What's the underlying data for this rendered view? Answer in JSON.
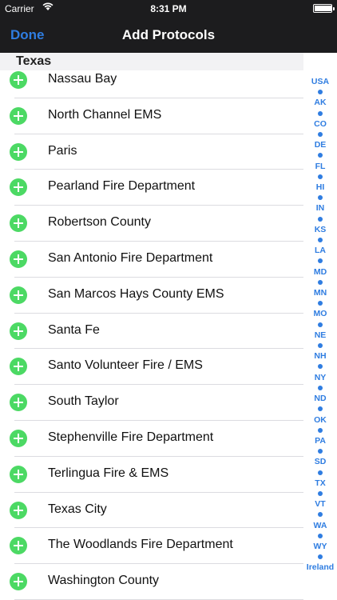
{
  "status_bar": {
    "carrier": "Carrier",
    "time": "8:31 PM",
    "battery_level": 0.95
  },
  "nav": {
    "done_label": "Done",
    "title": "Add Protocols"
  },
  "section": {
    "title": "Texas"
  },
  "rows": [
    "Nassau Bay",
    "North Channel EMS",
    "Paris",
    "Pearland Fire Department",
    "Robertson County",
    "San Antonio Fire Department",
    "San Marcos Hays County EMS",
    "Santa Fe",
    "Santo Volunteer Fire / EMS",
    "South Taylor",
    "Stephenville Fire Department",
    "Terlingua Fire & EMS",
    "Texas City",
    "The Woodlands Fire Department",
    "Washington County"
  ],
  "index": [
    "USA",
    "AK",
    "CO",
    "DE",
    "FL",
    "HI",
    "IN",
    "KS",
    "LA",
    "MD",
    "MN",
    "MO",
    "NE",
    "NH",
    "NY",
    "ND",
    "OK",
    "PA",
    "SD",
    "TX",
    "VT",
    "WA",
    "WY",
    "Ireland"
  ],
  "colors": {
    "accent": "#2f7de1",
    "add_button": "#4cd964",
    "bar": "#1c1c1e"
  }
}
